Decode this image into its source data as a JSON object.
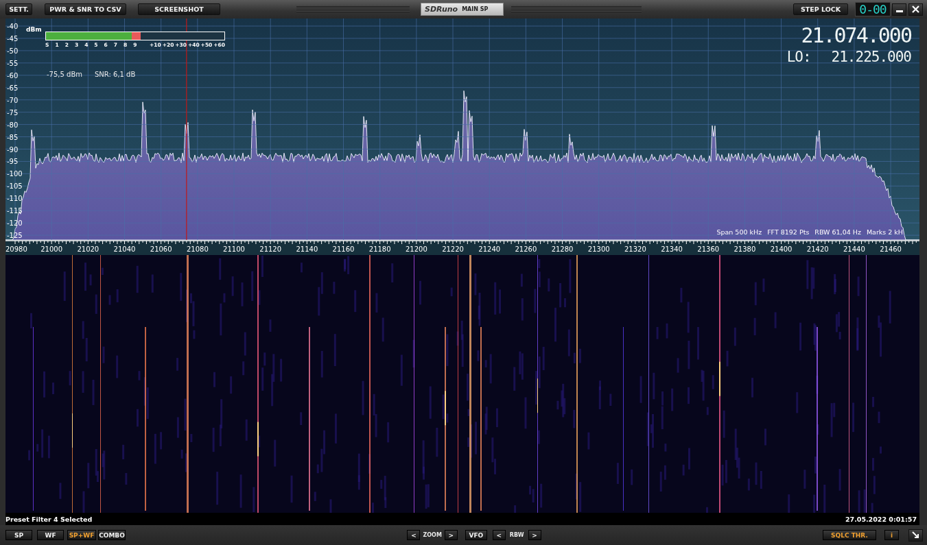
{
  "toolbar": {
    "buttons": [
      {
        "label": "SETT."
      },
      {
        "label": "PWR & SNR TO CSV"
      },
      {
        "label": "SCREENSHOT"
      }
    ],
    "logo": "SDRuno",
    "mode": "MAIN SP",
    "step_lock": "STEP LOCK",
    "counter": "0-00"
  },
  "spectrum": {
    "unit": "dBm",
    "y_labels": [
      "-40",
      "-45",
      "-50",
      "-55",
      "-60",
      "-65",
      "-70",
      "-75",
      "-80",
      "-85",
      "-90",
      "-95",
      "-100",
      "-105",
      "-110",
      "-115",
      "-120",
      "-125"
    ],
    "s_meter": {
      "level": 0.53,
      "s_scale": [
        "S",
        "1",
        "2",
        "3",
        "4",
        "5",
        "6",
        "7",
        "8",
        "9"
      ],
      "plus_scale": [
        "+10",
        "+20",
        "+30",
        "+40",
        "+50",
        "+60"
      ]
    },
    "power": "-75,5 dBm",
    "snr": "SNR: 6,1 dB",
    "frequency": "21.074.000",
    "lo_label": "LO:",
    "lo_frequency": "21.225.000",
    "info": [
      "Span 500 kHz",
      "FFT 8192 Pts",
      "RBW 61,04 Hz",
      "Marks 2 kH"
    ]
  },
  "x_labels": [
    "20980",
    "21000",
    "21020",
    "21040",
    "21060",
    "21080",
    "21100",
    "21120",
    "21140",
    "21160",
    "21180",
    "21200",
    "21220",
    "21240",
    "21260",
    "21280",
    "21300",
    "21320",
    "21340",
    "21360",
    "21380",
    "21400",
    "21420",
    "21440",
    "21460"
  ],
  "status": {
    "message": "Preset Filter 4 Selected",
    "datetime": "27.05.2022 0:01:57"
  },
  "bottom_bar": {
    "view_buttons": [
      {
        "label": "SP",
        "selected": false
      },
      {
        "label": "WF",
        "selected": false
      },
      {
        "label": "SP+WF",
        "selected": true
      },
      {
        "label": "COMBO",
        "selected": false
      }
    ],
    "zoom": {
      "prev": "<",
      "label": "ZOOM",
      "next": ">"
    },
    "vfo": "VFO",
    "rbw": {
      "prev": "<",
      "label": "RBW",
      "next": ">"
    },
    "sqlc": "SQLC THR.",
    "info": "i"
  }
}
